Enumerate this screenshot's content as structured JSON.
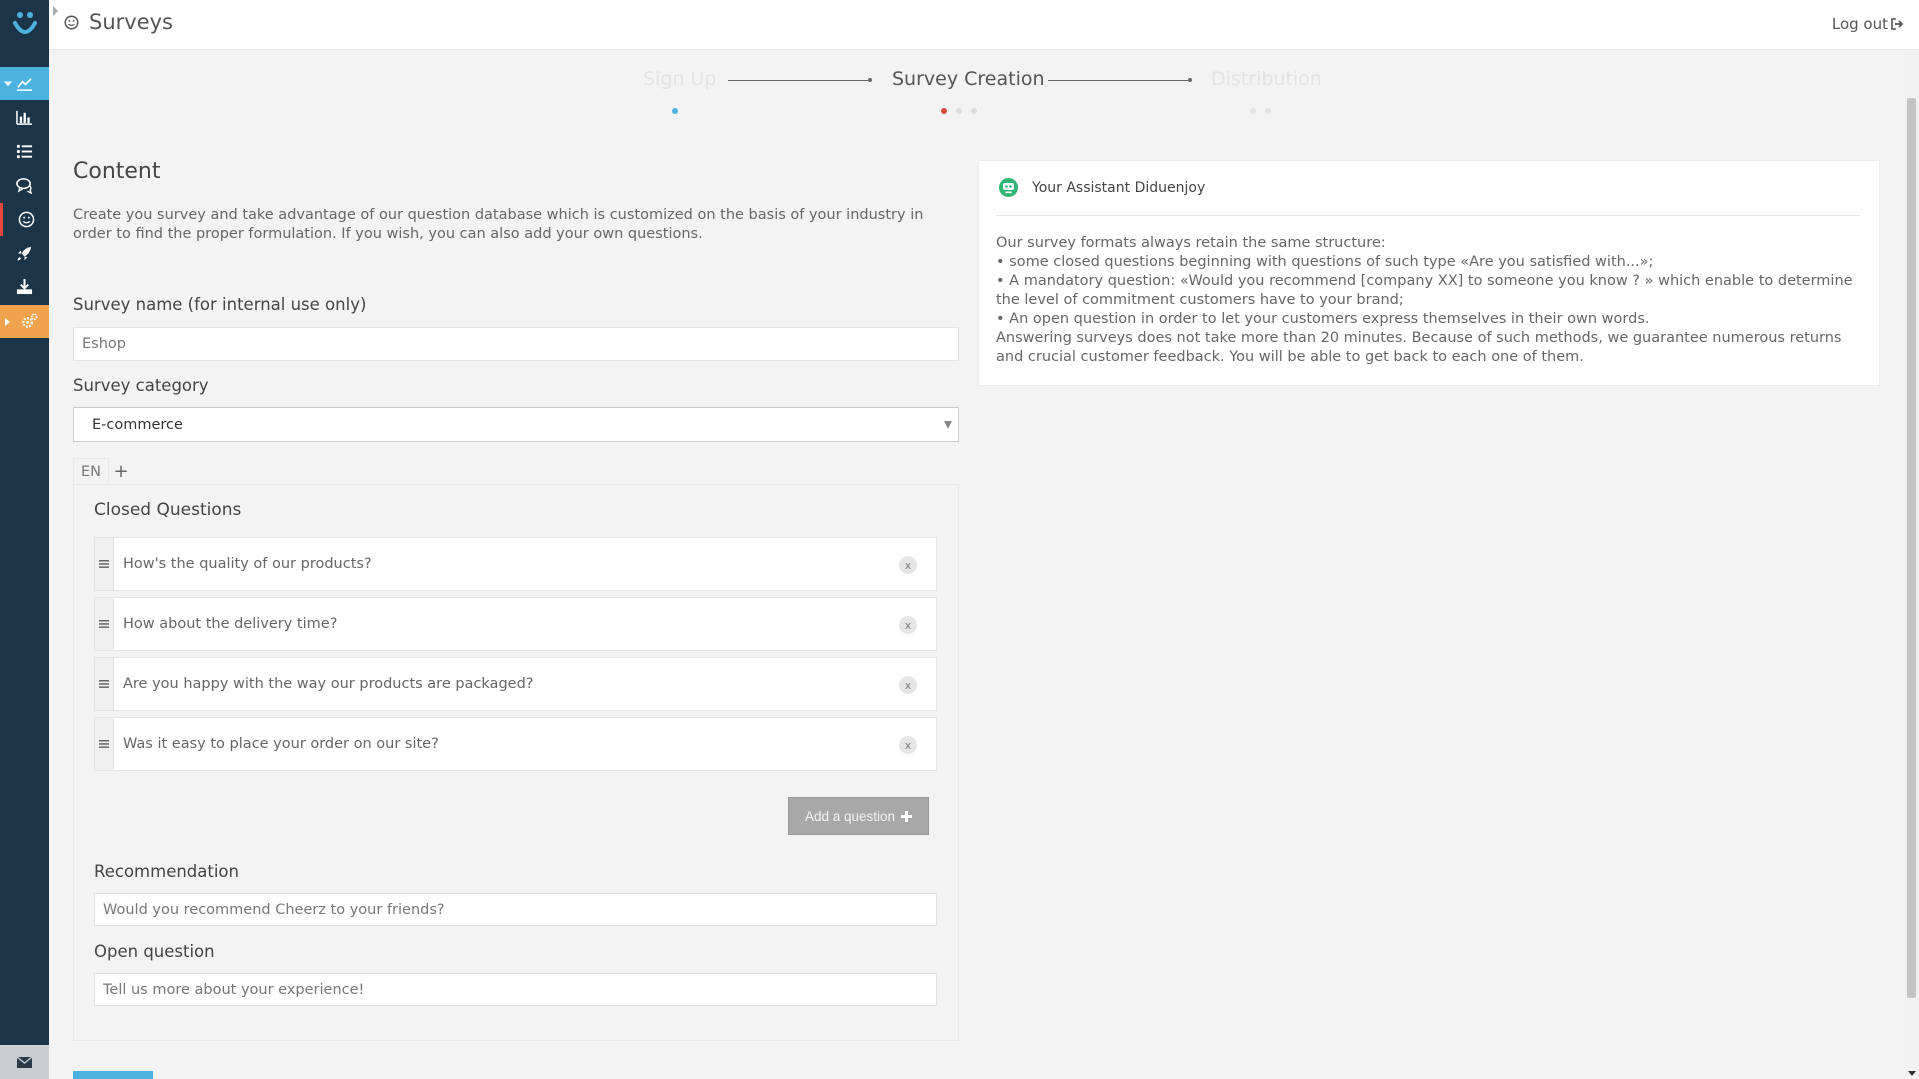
{
  "header": {
    "title": "Surveys",
    "logout": "Log out"
  },
  "sidebar": {
    "items": [
      {
        "icon": "line-chart-icon",
        "state": "active-blue"
      },
      {
        "icon": "bar-chart-icon"
      },
      {
        "icon": "list-icon"
      },
      {
        "icon": "comments-icon"
      },
      {
        "icon": "smile-icon",
        "state": "marked"
      },
      {
        "icon": "rocket-icon"
      },
      {
        "icon": "download-icon"
      },
      {
        "icon": "cogs-icon",
        "state": "active-orange"
      }
    ]
  },
  "stepper": {
    "steps": [
      "Sign Up",
      "Survey Creation",
      "Distribution"
    ],
    "current": 1
  },
  "content": {
    "title": "Content",
    "description": "Create you survey and take advantage of our question database which is customized on the basis of your industry in order to find the proper formulation. If you wish, you can also add your own questions.",
    "survey_name_label": "Survey name (for internal use only)",
    "survey_name_value": "Eshop",
    "category_label": "Survey category",
    "category_value": "E-commerce",
    "lang_tab": "EN",
    "lang_add": "+",
    "closed_questions_title": "Closed Questions",
    "closed_questions": [
      "How's the quality of our products?",
      "How about the delivery time?",
      "Are you happy with the way our products are packaged?",
      "Was it easy to place your order on our site?"
    ],
    "remove_label": "x",
    "add_question_label": "Add a question",
    "recommendation_label": "Recommendation",
    "recommendation_value": "Would you recommend Cheerz to your friends?",
    "open_question_label": "Open question",
    "open_question_value": "Tell us more about your experience!"
  },
  "assistant": {
    "name": "Your Assistant Diduenjoy",
    "lines": [
      "Our survey formats always retain the same structure:",
      "• some closed questions beginning with questions of such type «Are you satisfied with...»;",
      "• A mandatory question: «Would you recommend [company XX] to someone you know ? » which enable to determine the level of commitment customers have to your brand;",
      "• An open question in order to let your customers express themselves in their own words.",
      "Answering surveys does not take more than 20 minutes. Because of such methods, we guarantee numerous returns and crucial customer feedback. You will be able to get back to each one of them."
    ]
  },
  "colors": {
    "sidebar_bg": "#1c3447",
    "accent_blue": "#4bb2e0",
    "accent_orange": "#f0a34c",
    "accent_red": "#e0483c"
  }
}
